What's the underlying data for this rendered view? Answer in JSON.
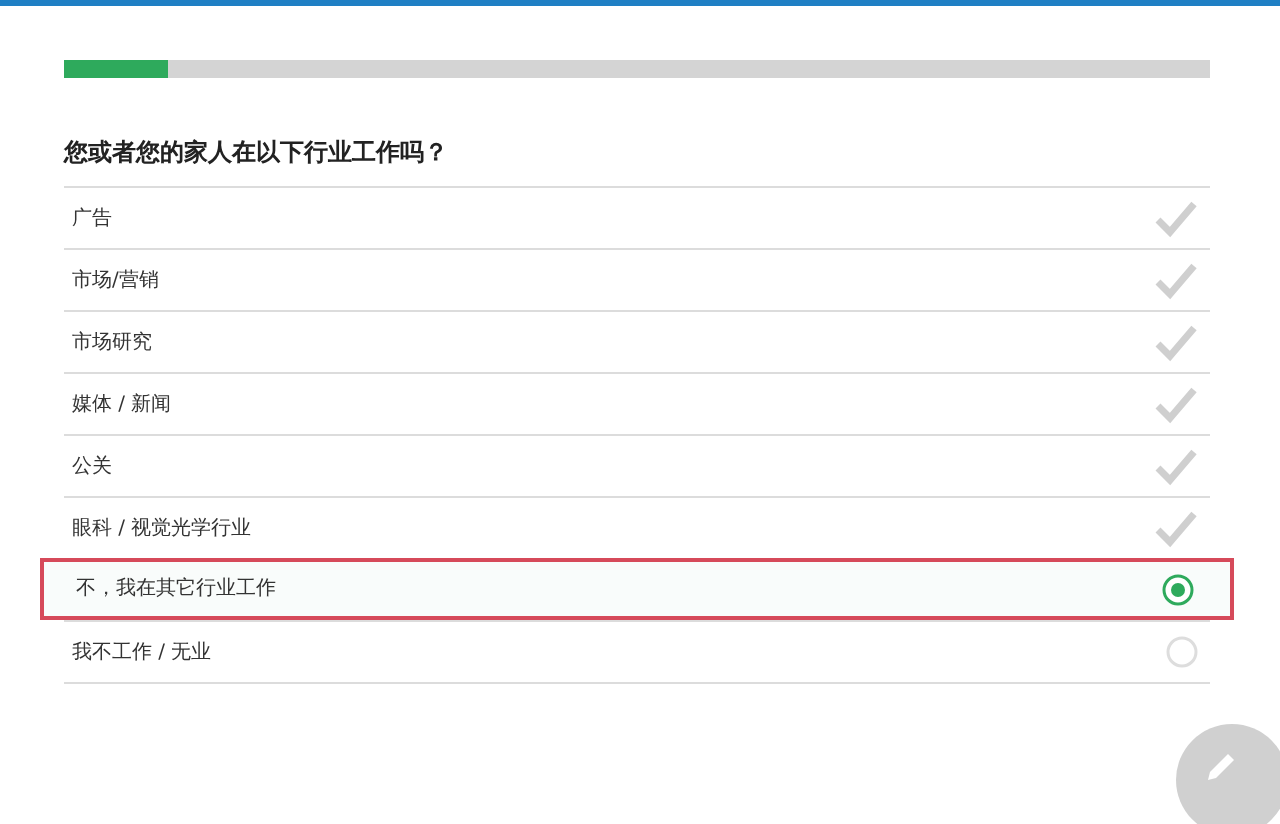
{
  "progress": {
    "level": 0.09
  },
  "question": "您或者您的家人在以下行业工作吗？",
  "options": [
    {
      "label": "广告",
      "kind": "check",
      "selected": false
    },
    {
      "label": "市场/营销",
      "kind": "check",
      "selected": false
    },
    {
      "label": "市场研究",
      "kind": "check",
      "selected": false
    },
    {
      "label": "媒体 / 新闻",
      "kind": "check",
      "selected": false
    },
    {
      "label": "公关",
      "kind": "check",
      "selected": false
    },
    {
      "label": "眼科 / 视觉光学行业",
      "kind": "check",
      "selected": false
    },
    {
      "label": "不，我在其它行业工作",
      "kind": "radio",
      "selected": true
    },
    {
      "label": "我不工作 / 无业",
      "kind": "radio",
      "selected": false
    }
  ]
}
